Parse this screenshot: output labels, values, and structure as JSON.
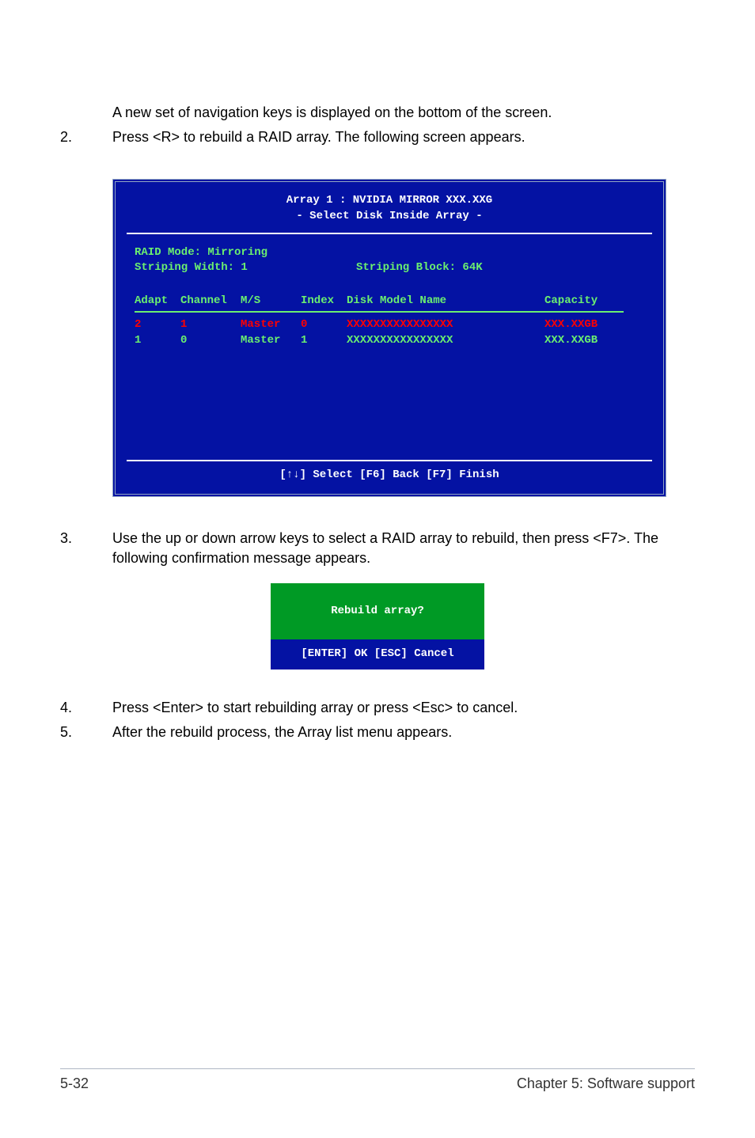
{
  "intro": {
    "line0": "A new set of  navigation keys is displayed on the bottom of the screen.",
    "item2_num": "2.",
    "item2_text": "Press <R> to rebuild a RAID array. The following screen appears."
  },
  "bios": {
    "title1": "Array 1 : NVIDIA MIRROR  XXX.XXG",
    "title2": "- Select Disk Inside Array -",
    "mode_label": "RAID Mode: Mirroring",
    "striping_width_label": "Striping Width: 1",
    "striping_block_label": "Striping Block: 64K",
    "headers": {
      "adapt": "Adapt",
      "channel": "Channel",
      "ms": "M/S",
      "index": "Index",
      "model": "Disk Model Name",
      "capacity": "Capacity"
    },
    "rows": [
      {
        "adapt": "2",
        "channel": "1",
        "ms": "Master",
        "index": "0",
        "model": "XXXXXXXXXXXXXXXX",
        "capacity": "XXX.XXGB",
        "highlight": true
      },
      {
        "adapt": "1",
        "channel": "0",
        "ms": "Master",
        "index": "1",
        "model": "XXXXXXXXXXXXXXXX",
        "capacity": "XXX.XXGB",
        "highlight": false
      }
    ],
    "footer": "[↑↓] Select [F6] Back  [F7] Finish"
  },
  "item3": {
    "num": "3.",
    "text": "Use the up or down arrow keys to select a RAID array to rebuild, then press <F7>. The following confirmation message appears."
  },
  "dialog": {
    "prompt": "Rebuild array?",
    "keys": "[ENTER] OK   [ESC] Cancel"
  },
  "item4": {
    "num": "4.",
    "text": "Press <Enter> to start rebuilding array or press <Esc> to cancel."
  },
  "item5": {
    "num": "5.",
    "text": "After the rebuild process, the Array list menu appears."
  },
  "footer": {
    "left": "5-32",
    "right": "Chapter 5: Software support"
  }
}
